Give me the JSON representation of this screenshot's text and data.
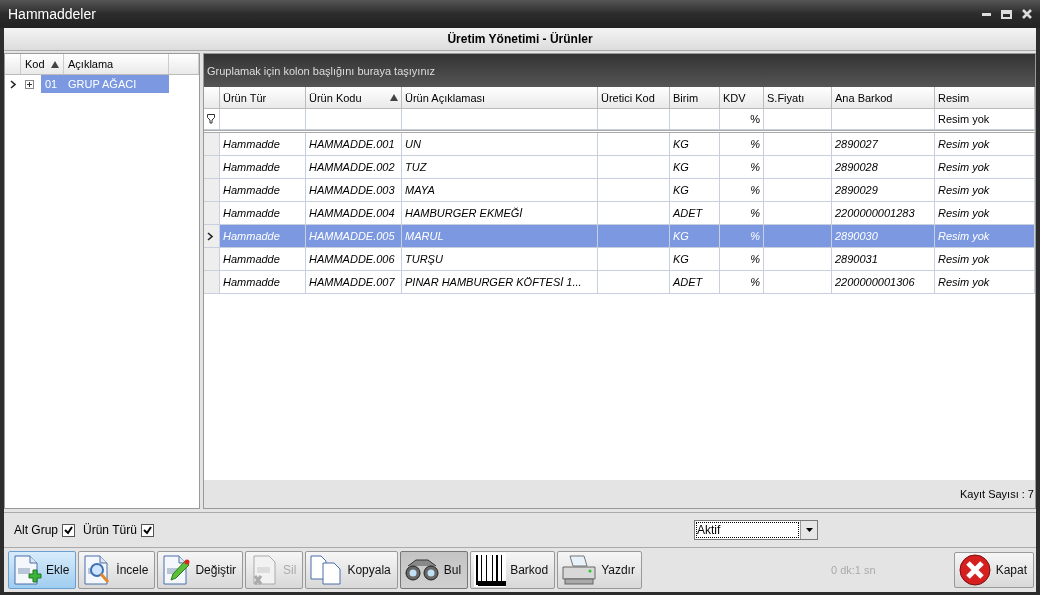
{
  "window": {
    "title": "Hammaddeler"
  },
  "header": {
    "title": "Üretim Yönetimi - Ürünler"
  },
  "left_grid": {
    "columns": [
      {
        "label": "Kod",
        "sorted": true
      },
      {
        "label": "Açıklama",
        "sorted": false
      }
    ],
    "rows": [
      {
        "kod": "01",
        "aciklama": "GRUP AĞACI",
        "expanded": false,
        "selected": true
      }
    ]
  },
  "grid": {
    "group_panel_hint": "Gruplamak için kolon başlığını buraya taşıyınız",
    "columns": [
      {
        "label": "Ürün Tür",
        "sorted": false
      },
      {
        "label": "Ürün Kodu",
        "sorted": true
      },
      {
        "label": "Ürün Açıklaması",
        "sorted": false
      },
      {
        "label": "Üretici Kod",
        "sorted": false
      },
      {
        "label": "Birim",
        "sorted": false
      },
      {
        "label": "KDV",
        "sorted": false
      },
      {
        "label": "S.Fiyatı",
        "sorted": false
      },
      {
        "label": "Ana Barkod",
        "sorted": false
      },
      {
        "label": "Resim",
        "sorted": false
      }
    ],
    "filter_row": {
      "kdv": "%",
      "resim": "Resim yok"
    },
    "rows": [
      {
        "cells": [
          "Hammadde",
          "HAMMADDE.001",
          "UN",
          "",
          "KG",
          "%",
          "",
          "2890027",
          "Resim yok"
        ],
        "selected": false
      },
      {
        "cells": [
          "Hammadde",
          "HAMMADDE.002",
          "TUZ",
          "",
          "KG",
          "%",
          "",
          "2890028",
          "Resim yok"
        ],
        "selected": false
      },
      {
        "cells": [
          "Hammadde",
          "HAMMADDE.003",
          "MAYA",
          "",
          "KG",
          "%",
          "",
          "2890029",
          "Resim yok"
        ],
        "selected": false
      },
      {
        "cells": [
          "Hammadde",
          "HAMMADDE.004",
          "HAMBURGER EKMEĞİ",
          "",
          "ADET",
          "%",
          "",
          "2200000001283",
          "Resim yok"
        ],
        "selected": false
      },
      {
        "cells": [
          "Hammadde",
          "HAMMADDE.005",
          "MARUL",
          "",
          "KG",
          "%",
          "",
          "2890030",
          "Resim yok"
        ],
        "selected": true
      },
      {
        "cells": [
          "Hammadde",
          "HAMMADDE.006",
          "TURŞU",
          "",
          "KG",
          "%",
          "",
          "2890031",
          "Resim yok"
        ],
        "selected": false
      },
      {
        "cells": [
          "Hammadde",
          "HAMMADDE.007",
          "PINAR HAMBURGER KÖFTESİ 1...",
          "",
          "ADET",
          "%",
          "",
          "2200000001306",
          "Resim yok"
        ],
        "selected": false
      }
    ],
    "record_count": "Kayıt Sayısı : 7"
  },
  "options": {
    "checkboxes": [
      {
        "label": "Alt Grup",
        "checked": true
      },
      {
        "label": "Ürün Türü",
        "checked": true
      }
    ],
    "status_dropdown": {
      "value": "Aktif"
    }
  },
  "toolbar": {
    "buttons": [
      {
        "label": "Ekle",
        "kind": "add",
        "disabled": false,
        "hot": true,
        "pressed": false
      },
      {
        "label": "İncele",
        "kind": "inspect",
        "disabled": false,
        "hot": false,
        "pressed": false
      },
      {
        "label": "Değiştir",
        "kind": "edit",
        "disabled": false,
        "hot": false,
        "pressed": false
      },
      {
        "label": "Sil",
        "kind": "delete",
        "disabled": true,
        "hot": false,
        "pressed": false
      },
      {
        "label": "Kopyala",
        "kind": "copy",
        "disabled": false,
        "hot": false,
        "pressed": false
      },
      {
        "label": "Bul",
        "kind": "find",
        "disabled": false,
        "hot": false,
        "pressed": true
      },
      {
        "label": "Barkod",
        "kind": "barcode",
        "disabled": false,
        "hot": false,
        "pressed": false
      },
      {
        "label": "Yazdır",
        "kind": "print",
        "disabled": false,
        "hot": false,
        "pressed": false
      }
    ],
    "timer": "0 dk:1 sn",
    "close_button": {
      "label": "Kapat",
      "kind": "close"
    }
  }
}
